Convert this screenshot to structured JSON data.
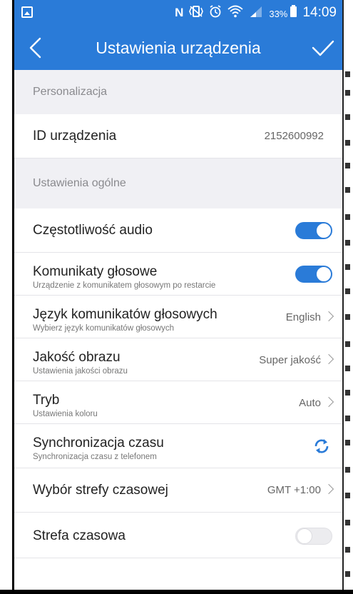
{
  "status_bar": {
    "battery_percent": "33%",
    "time": "14:09",
    "icons": [
      "notification-image-icon",
      "nfc-icon",
      "vibrate-icon",
      "alarm-icon",
      "wifi-icon",
      "signal-icon",
      "battery-charging-icon"
    ]
  },
  "app_bar": {
    "title": "Ustawienia urządzenia",
    "back_icon": "chevron-left-icon",
    "confirm_icon": "check-icon",
    "color": "#2a7bd8"
  },
  "sections": {
    "personalization": "Personalizacja",
    "general": "Ustawienia ogólne"
  },
  "device_id": {
    "label": "ID urządzenia",
    "value": "2152600992"
  },
  "settings": {
    "audio_frequency": {
      "label": "Częstotliwość audio",
      "enabled": true
    },
    "voice_messages": {
      "label": "Komunikaty głosowe",
      "sub": "Urządzenie z komunikatem głosowym po restarcie",
      "enabled": true
    },
    "voice_language": {
      "label": "Język komunikatów głosowych",
      "sub": "Wybierz język komunikatów głosowych",
      "value": "English"
    },
    "image_quality": {
      "label": "Jakość obrazu",
      "sub": "Ustawienia jakości obrazu",
      "value": "Super jakość"
    },
    "mode": {
      "label": "Tryb",
      "sub": "Ustawienia koloru",
      "value": "Auto"
    },
    "time_sync": {
      "label": "Synchronizacja czasu",
      "sub": "Synchronizacja czasu z telefonem",
      "icon": "sync-icon"
    },
    "timezone_select": {
      "label": "Wybór strefy czasowej",
      "value": "GMT +1:00"
    },
    "timezone": {
      "label": "Strefa czasowa",
      "enabled": false
    }
  }
}
